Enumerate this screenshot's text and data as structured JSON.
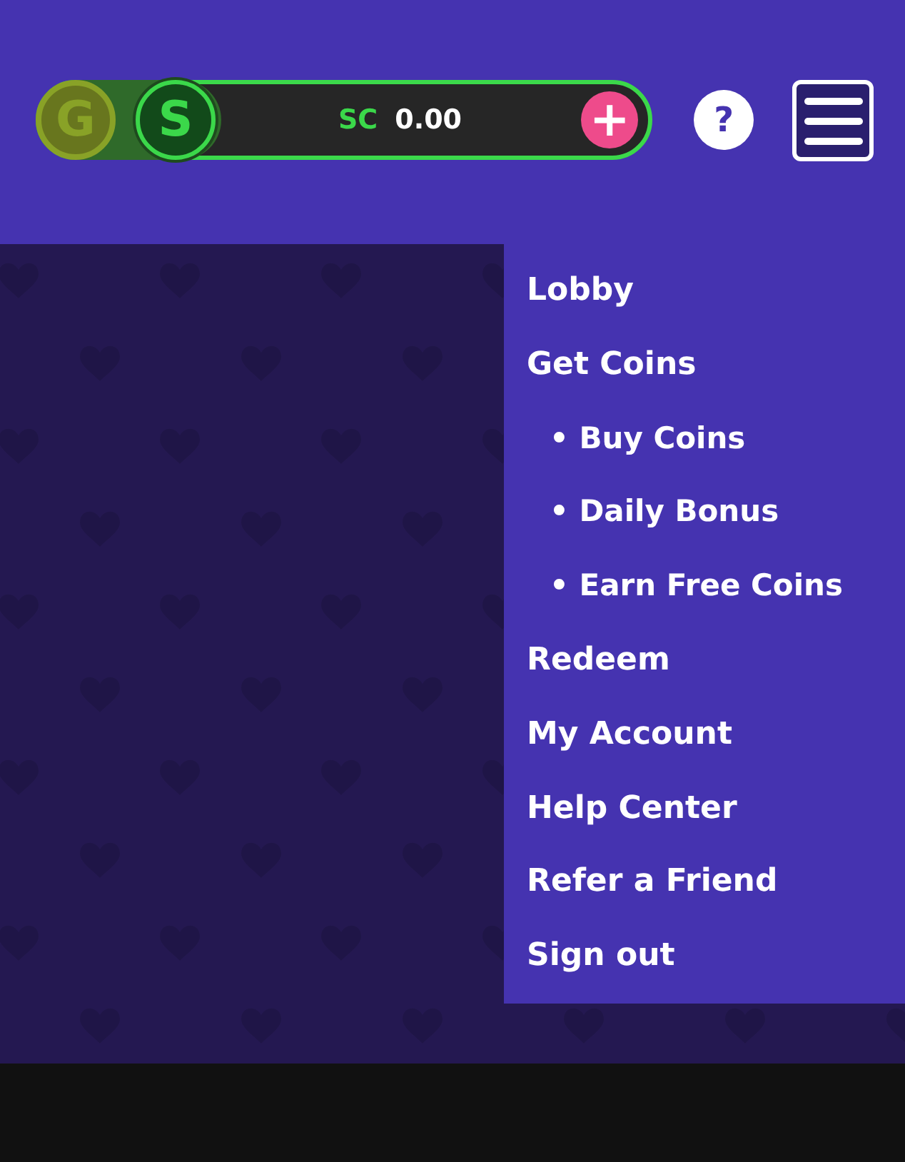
{
  "currency_toggle": {
    "coins": [
      {
        "label": "G",
        "selected": false
      },
      {
        "label": "S",
        "selected": true
      }
    ],
    "currency": "SC",
    "balance": "0.00",
    "add_label": "+"
  },
  "help_label": "?",
  "menu": {
    "expanded": true,
    "items": [
      {
        "kind": "item",
        "label": "Lobby"
      },
      {
        "kind": "item",
        "label": "Get Coins"
      },
      {
        "kind": "subitem",
        "label": "• Buy Coins"
      },
      {
        "kind": "subitem",
        "label": "• Daily Bonus"
      },
      {
        "kind": "subitem",
        "label": "• Earn Free Coins"
      },
      {
        "kind": "item",
        "label": "Redeem"
      },
      {
        "kind": "item",
        "label": "My Account"
      },
      {
        "kind": "item",
        "label": "Help Center"
      },
      {
        "kind": "item",
        "label": "Refer a Friend"
      },
      {
        "kind": "item",
        "label": "Sign out"
      }
    ]
  }
}
